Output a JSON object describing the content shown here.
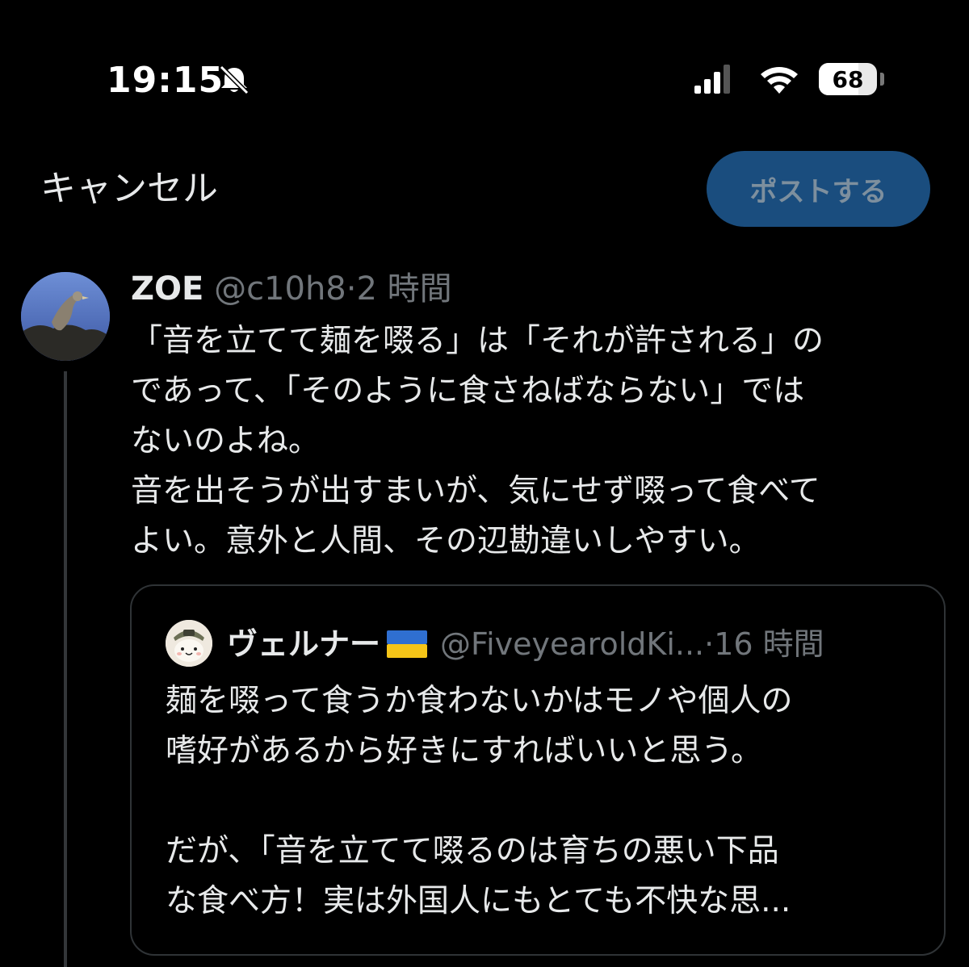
{
  "status_bar": {
    "time": "19:15",
    "battery_level": "68",
    "battery_fraction": 0.68,
    "icons": [
      "bell-slash-icon",
      "signal-icon",
      "wifi-icon",
      "battery-icon"
    ]
  },
  "header": {
    "cancel_label": "キャンセル",
    "post_label": "ポストする",
    "post_button_color": "#1a4d7e"
  },
  "tweet": {
    "display_name": "ZOE",
    "handle": "@c10h8",
    "separator": "·",
    "timestamp": "2 時間",
    "lines": [
      "「音を立てて麺を啜る」は「それが許される」の",
      "であって、「そのように食さねばならない」では",
      "ないのよね。",
      "音を出そうが出すまいが、気にせず啜って食べて",
      "よい。意外と人間、その辺勘違いしやすい。"
    ]
  },
  "quote": {
    "display_name": "ヴェルナー",
    "flag_icon": "ukraine-flag-icon",
    "handle": "@FiveyearoldKi...",
    "separator": "·",
    "timestamp": "16 時間",
    "lines": [
      "麺を啜って食うか食わないかはモノや個人の",
      "嗜好があるから好きにすればいいと思う。",
      "",
      "だが、「音を立てて啜るのは育ちの悪い下品",
      "な食べ方！実は外国人にもとても不快な思..."
    ]
  }
}
